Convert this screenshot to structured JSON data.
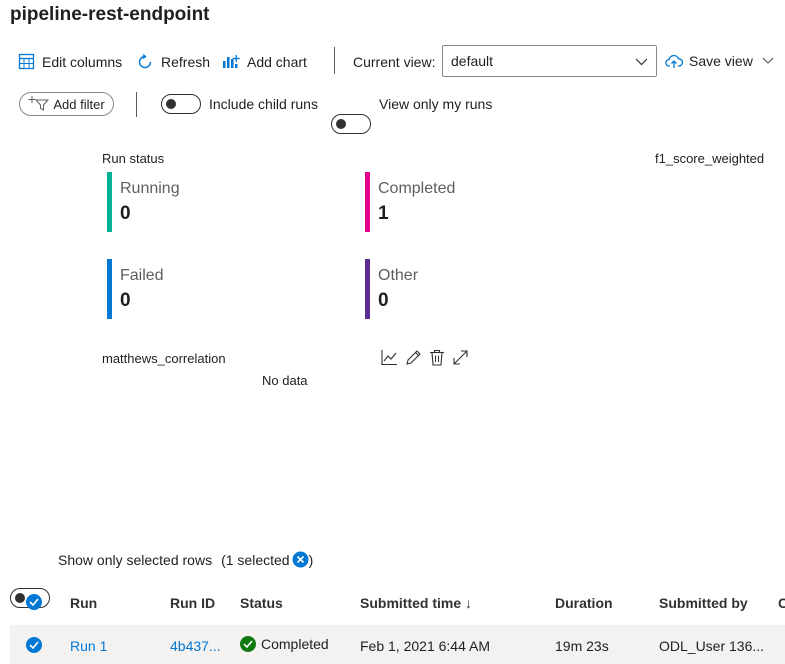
{
  "header": {
    "title": "pipeline-rest-endpoint"
  },
  "toolbar": {
    "edit_columns": "Edit columns",
    "refresh": "Refresh",
    "add_chart": "Add chart",
    "current_view_label": "Current view:",
    "current_view_value": "default",
    "save_view": "Save view"
  },
  "filters": {
    "add_filter": "Add filter",
    "include_child_runs": "Include child runs",
    "view_only_my_runs": "View only my runs"
  },
  "run_status": {
    "title": "Run status",
    "tiles": [
      {
        "label": "Running",
        "value": "0",
        "color": "#00b294"
      },
      {
        "label": "Completed",
        "value": "1",
        "color": "#e3008c"
      },
      {
        "label": "Failed",
        "value": "0",
        "color": "#0078d4"
      },
      {
        "label": "Other",
        "value": "0",
        "color": "#5c2d91"
      }
    ]
  },
  "metric_charts": {
    "f1_title": "f1_score_weighted",
    "mcc_title": "matthews_correlation",
    "no_data": "No data",
    "icons": [
      "line-chart-icon",
      "edit-icon",
      "delete-icon",
      "expand-icon"
    ]
  },
  "selection": {
    "show_selected_label": "Show only selected rows",
    "selected_prefix": "(1 selected",
    "selected_suffix": ")"
  },
  "table": {
    "columns": [
      "Run",
      "Run ID",
      "Status",
      "Submitted time ↓",
      "Duration",
      "Submitted by",
      "C"
    ],
    "rows": [
      {
        "run": "Run 1",
        "run_id": "4b437...",
        "status": "Completed",
        "submitted_time": "Feb 1, 2021 6:44 AM",
        "duration": "19m 23s",
        "submitted_by": "ODL_User 136..."
      }
    ]
  },
  "colors": {
    "accent": "#0078d4",
    "success": "#107c10"
  }
}
